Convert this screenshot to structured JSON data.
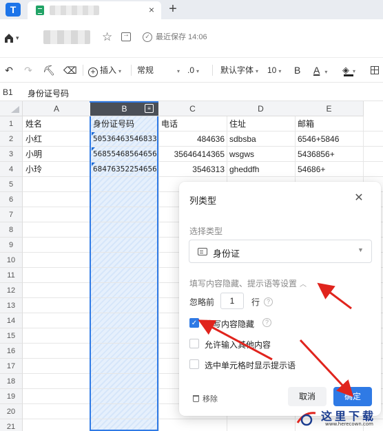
{
  "browser": {
    "new_tab": "+",
    "close_tab": "×"
  },
  "doc": {
    "save_status": "最近保存 14:06"
  },
  "toolbar": {
    "insert": "插入",
    "format": "常规",
    "decimal": ".0",
    "font": "默认字体",
    "font_size": "10",
    "bold": "B",
    "text_color": "A"
  },
  "formula_bar": {
    "cell_ref": "B1",
    "content": "身份证号码"
  },
  "grid": {
    "columns": [
      "A",
      "B",
      "C",
      "D",
      "E"
    ],
    "rows": [
      "1",
      "2",
      "3",
      "4",
      "5",
      "6",
      "7",
      "8",
      "9",
      "10",
      "11",
      "12",
      "13",
      "14",
      "15",
      "16",
      "17",
      "18",
      "19",
      "20",
      "21"
    ],
    "data": [
      [
        "姓名",
        "身份证号码",
        "电话",
        "住址",
        "邮箱"
      ],
      [
        "小红",
        "50536463546833",
        "484636",
        "sdbsba",
        "6546+5846"
      ],
      [
        "小明",
        "56855468564656",
        "35646414365",
        "wsgws",
        "5436856+"
      ],
      [
        "小玲",
        "68476352254656",
        "3546313",
        "gheddfh",
        "54686+"
      ]
    ]
  },
  "dialog": {
    "title": "列类型",
    "select_label": "选择类型",
    "select_value": "身份证",
    "section_title": "填写内容隐藏、提示语等设置",
    "ignore_prefix": "忽略前",
    "ignore_value": "1",
    "ignore_unit": "行",
    "option_hide": "填写内容隐藏",
    "option_allow_other": "允许输入其他内容",
    "option_show_hint": "选中单元格时显示提示语",
    "remove": "移除",
    "cancel": "取消",
    "ok": "确定"
  },
  "watermark": {
    "text": "这里下载",
    "url": "www.herecown.com"
  },
  "colors": {
    "accent": "#2f7ae5",
    "annotation_red": "#e0241d",
    "app_logo": "#1c74e9",
    "sheet_green": "#21a366"
  },
  "icons": [
    "app-logo-icon",
    "sheet-icon",
    "home-icon",
    "star-icon",
    "share-icon",
    "save-check-icon",
    "undo-icon",
    "redo-icon",
    "format-painter-icon",
    "eraser-icon",
    "insert-plus-icon",
    "fill-color-icon",
    "border-grid-icon",
    "filter-icon",
    "id-card-icon",
    "close-icon",
    "help-icon",
    "trash-icon"
  ]
}
